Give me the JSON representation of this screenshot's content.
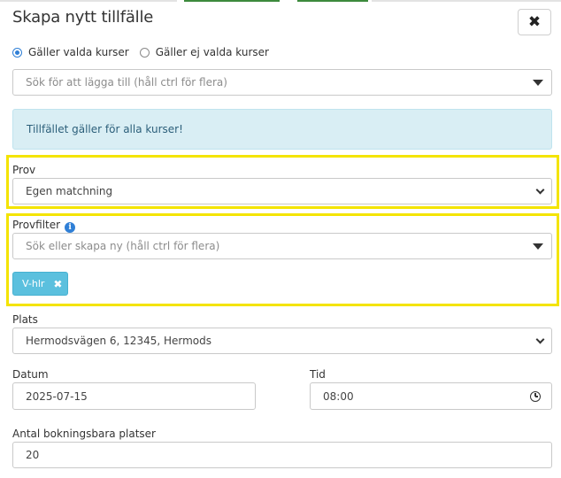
{
  "colors": {
    "accent": "#2f7fd6",
    "highlight": "#f4e400",
    "info_bg": "#d9eef4",
    "tag_bg": "#5bc0de",
    "topline_green": "#3c8a3c"
  },
  "dialog": {
    "title": "Skapa nytt tillfälle",
    "close_icon": "close-icon"
  },
  "scope": {
    "option_selected": "Gäller valda kurser",
    "option_other": "Gäller ej valda kurser",
    "selected_index": 0
  },
  "course_search": {
    "placeholder": "Sök för att lägga till (håll ctrl för flera)"
  },
  "info": {
    "text": "Tillfället gäller för alla kurser!"
  },
  "prov": {
    "label": "Prov",
    "value": "Egen matchning"
  },
  "provfilter": {
    "label": "Provfilter",
    "info_icon": "info-icon",
    "placeholder": "Sök eller skapa ny (håll ctrl för flera)",
    "tags": [
      {
        "label": "V-hlr"
      }
    ]
  },
  "plats": {
    "label": "Plats",
    "value": "Hermodsvägen 6, 12345, Hermods"
  },
  "datum": {
    "label": "Datum",
    "value": "2025-07-15"
  },
  "tid": {
    "label": "Tid",
    "value": "08:00"
  },
  "antal": {
    "label": "Antal bokningsbara platser",
    "value": "20"
  }
}
